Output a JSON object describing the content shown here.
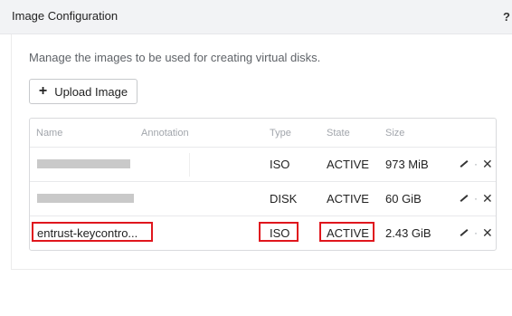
{
  "header": {
    "title": "Image Configuration",
    "help": "?"
  },
  "description": "Manage the images to be used for creating virtual disks.",
  "upload_button": {
    "label": "Upload Image",
    "icon": "+"
  },
  "table": {
    "columns": [
      "Name",
      "Annotation",
      "Type",
      "State",
      "Size"
    ],
    "rows": [
      {
        "name": "",
        "type": "ISO",
        "state": "ACTIVE",
        "size": "973 MiB"
      },
      {
        "name": "",
        "type": "DISK",
        "state": "ACTIVE",
        "size": "60 GiB"
      },
      {
        "name": "entrust-keycontro...",
        "type": "ISO",
        "state": "ACTIVE",
        "size": "2.43 GiB"
      }
    ],
    "action_separator": "·"
  },
  "colors": {
    "highlight": "#e0161d",
    "redaction": "#c9c9c9",
    "header_bg": "#f2f3f5"
  }
}
